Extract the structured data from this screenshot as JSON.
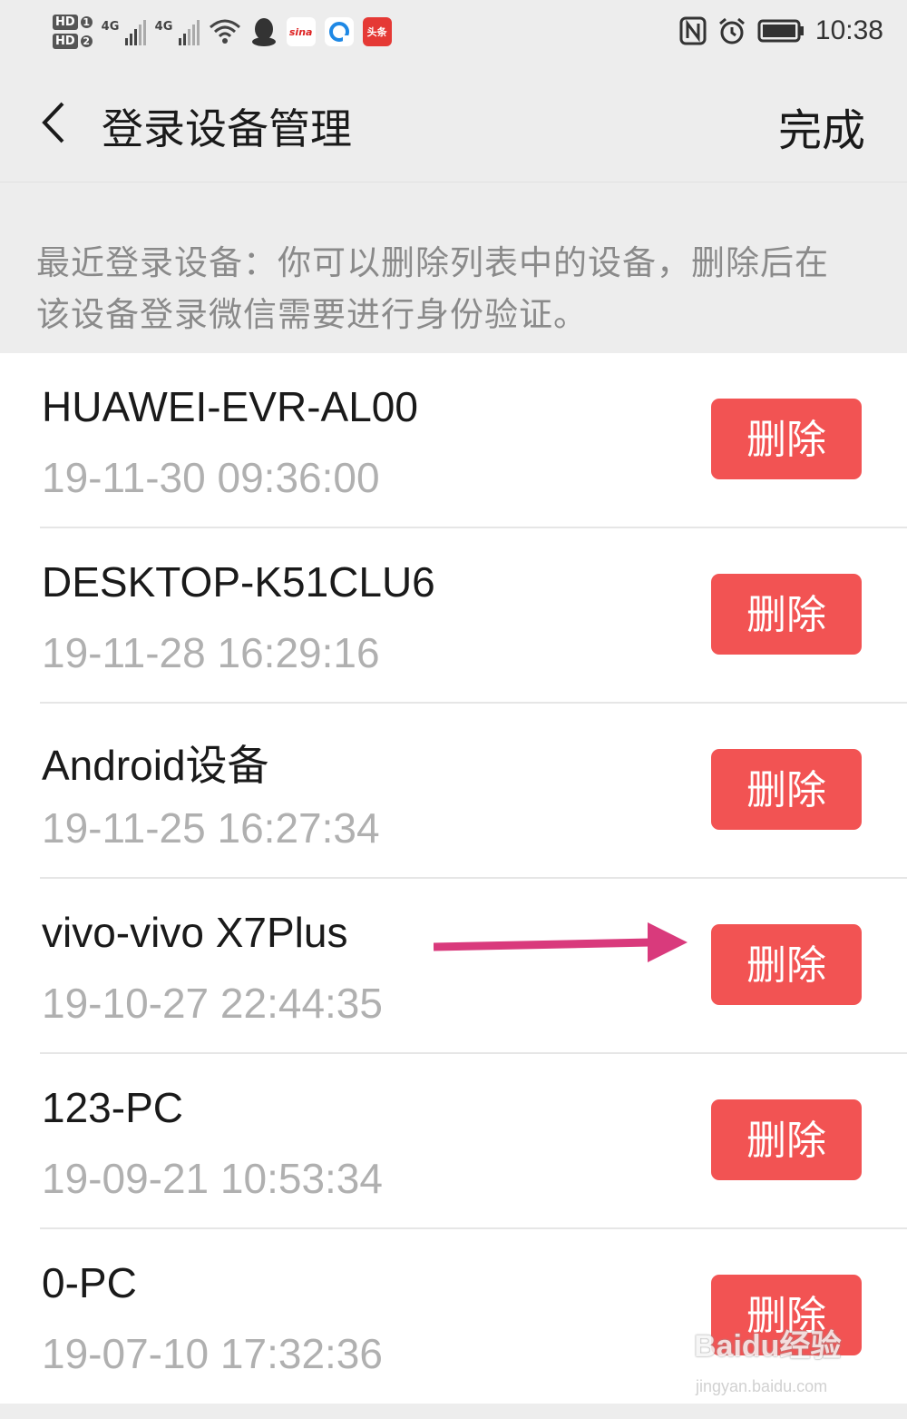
{
  "status_bar": {
    "sim1": "HD",
    "sim1_index": "1",
    "sim2": "HD",
    "sim2_index": "2",
    "network1": "4G",
    "network2": "4G",
    "app_sina": "sina",
    "app_toutiao": "头条",
    "time": "10:38"
  },
  "header": {
    "title": "登录设备管理",
    "done_label": "完成"
  },
  "info": {
    "text": "最近登录设备：你可以删除列表中的设备，删除后在该设备登录微信需要进行身份验证。"
  },
  "devices": [
    {
      "name": "HUAWEI-EVR-AL00",
      "date": "19-11-30 09:36:00",
      "delete_label": "删除"
    },
    {
      "name": "DESKTOP-K51CLU6",
      "date": "19-11-28 16:29:16",
      "delete_label": "删除"
    },
    {
      "name": "Android设备",
      "date": "19-11-25 16:27:34",
      "delete_label": "删除"
    },
    {
      "name": "vivo-vivo X7Plus",
      "date": "19-10-27 22:44:35",
      "delete_label": "删除"
    },
    {
      "name": "123-PC",
      "date": "19-09-21 10:53:34",
      "delete_label": "删除"
    },
    {
      "name": "0-PC",
      "date": "19-07-10 17:32:36",
      "delete_label": "删除"
    }
  ],
  "watermark": {
    "brand": "Baidu经验",
    "url": "jingyan.baidu.com"
  },
  "colors": {
    "delete_button": "#f25353",
    "annotation_arrow": "#d93a7c",
    "background": "#ededed"
  }
}
